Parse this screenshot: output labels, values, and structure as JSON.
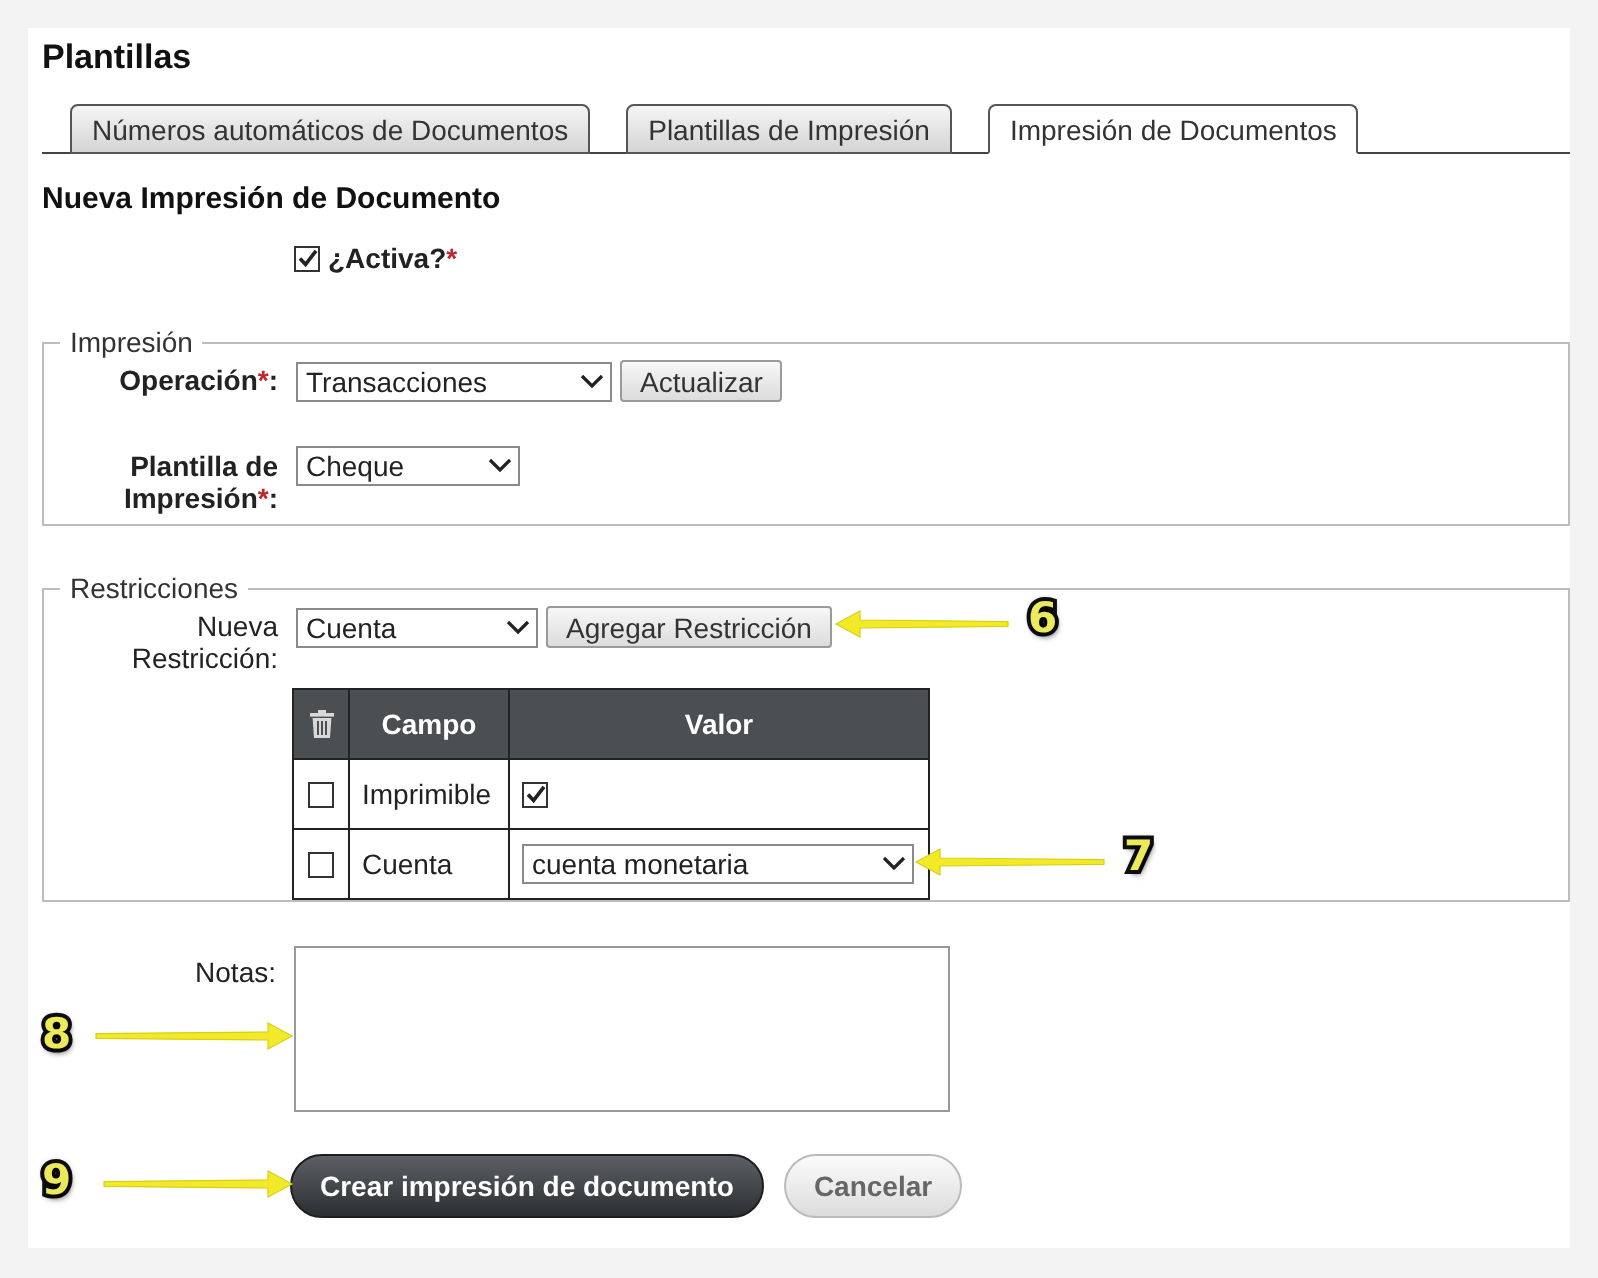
{
  "page_title": "Plantillas",
  "tabs": [
    {
      "label": "Números automáticos de Documentos",
      "selected": false
    },
    {
      "label": "Plantillas de Impresión",
      "selected": false
    },
    {
      "label": "Impresión de Documentos",
      "selected": true
    }
  ],
  "form_title": "Nueva Impresión de Documento",
  "active": {
    "label": "¿Activa?",
    "required_mark": "*",
    "checked": true
  },
  "printing": {
    "legend": "Impresión",
    "operation": {
      "label": "Operación",
      "required_mark": "*",
      "label_end": ":",
      "value": "Transacciones",
      "button": "Actualizar"
    },
    "template": {
      "label": "Plantilla de Impresión",
      "required_mark": "*",
      "label_end": ":",
      "value": "Cheque"
    }
  },
  "restrictions": {
    "legend": "Restricciones",
    "new_restriction": {
      "label": "Nueva Restricción:",
      "value": "Cuenta",
      "button": "Agregar Restricción"
    },
    "table": {
      "columns": [
        "Campo",
        "Valor"
      ],
      "rows": [
        {
          "checked": false,
          "field": "Imprimible",
          "kind": "checkbox",
          "value_checked": true
        },
        {
          "checked": false,
          "field": "Cuenta",
          "kind": "select",
          "value": "cuenta monetaria"
        }
      ]
    }
  },
  "notes": {
    "label": "Notas:"
  },
  "buttons": [
    {
      "label": "Crear impresión de documento",
      "kind": "primary"
    },
    {
      "label": "Cancelar",
      "kind": "secondary"
    }
  ],
  "annotations": [
    {
      "number": "6",
      "kind": "leftward"
    },
    {
      "number": "7",
      "kind": "leftward"
    },
    {
      "number": "8",
      "kind": "rightward"
    },
    {
      "number": "9",
      "kind": "rightward"
    }
  ]
}
